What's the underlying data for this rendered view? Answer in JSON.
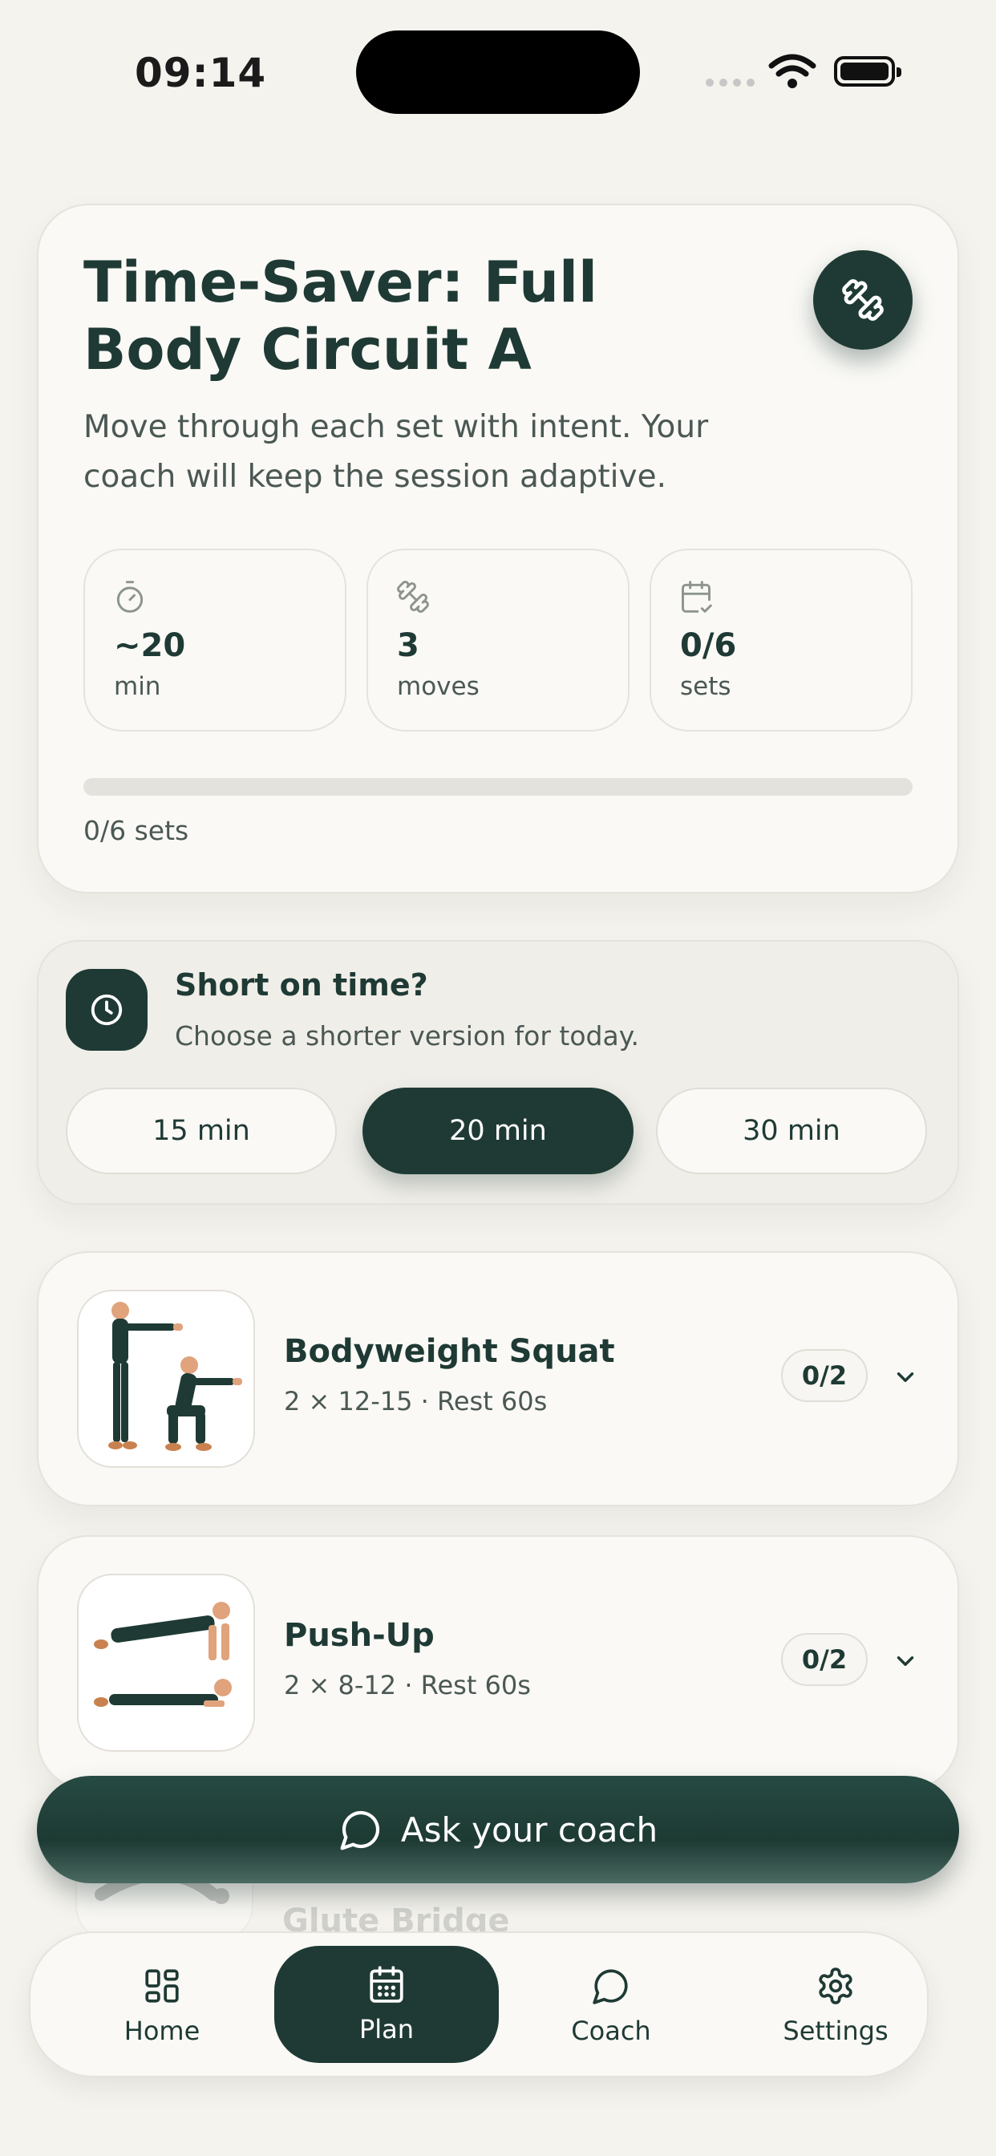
{
  "status_bar": {
    "time": "09:14"
  },
  "workout": {
    "title": "Time-Saver: Full Body Circuit A",
    "subtitle": "Move through each set with intent. Your coach will keep the session adaptive.",
    "stats": [
      {
        "icon": "stopwatch-icon",
        "value": "~20",
        "label": "min"
      },
      {
        "icon": "dumbbell-icon",
        "value": "3",
        "label": "moves"
      },
      {
        "icon": "calendar-check-icon",
        "value": "0/6",
        "label": "sets"
      }
    ],
    "progress": {
      "completed": 0,
      "total": 6,
      "fraction": 0,
      "label": "0/6 sets"
    }
  },
  "short_on_time": {
    "title": "Short on time?",
    "subtitle": "Choose a shorter version for today.",
    "options": [
      "15 min",
      "20 min",
      "30 min"
    ],
    "selected": "20 min"
  },
  "exercises": [
    {
      "name": "Bodyweight Squat",
      "meta": "2 × 12-15 · Rest 60s",
      "progress": "0/2"
    },
    {
      "name": "Push-Up",
      "meta": "2 × 8-12 · Rest 60s",
      "progress": "0/2"
    },
    {
      "name": "Glute Bridge"
    }
  ],
  "ask_coach": {
    "label": "Ask your coach"
  },
  "nav": {
    "items": [
      {
        "label": "Home",
        "icon": "grid-icon"
      },
      {
        "label": "Plan",
        "icon": "calendar-icon"
      },
      {
        "label": "Coach",
        "icon": "chat-icon"
      },
      {
        "label": "Settings",
        "icon": "gear-icon"
      }
    ],
    "active": "Plan"
  },
  "colors": {
    "primary": "#1f3a34",
    "background": "#f5f3ee",
    "card": "#faf9f6",
    "skin": "#e0a37c",
    "shoe": "#c9824f"
  }
}
